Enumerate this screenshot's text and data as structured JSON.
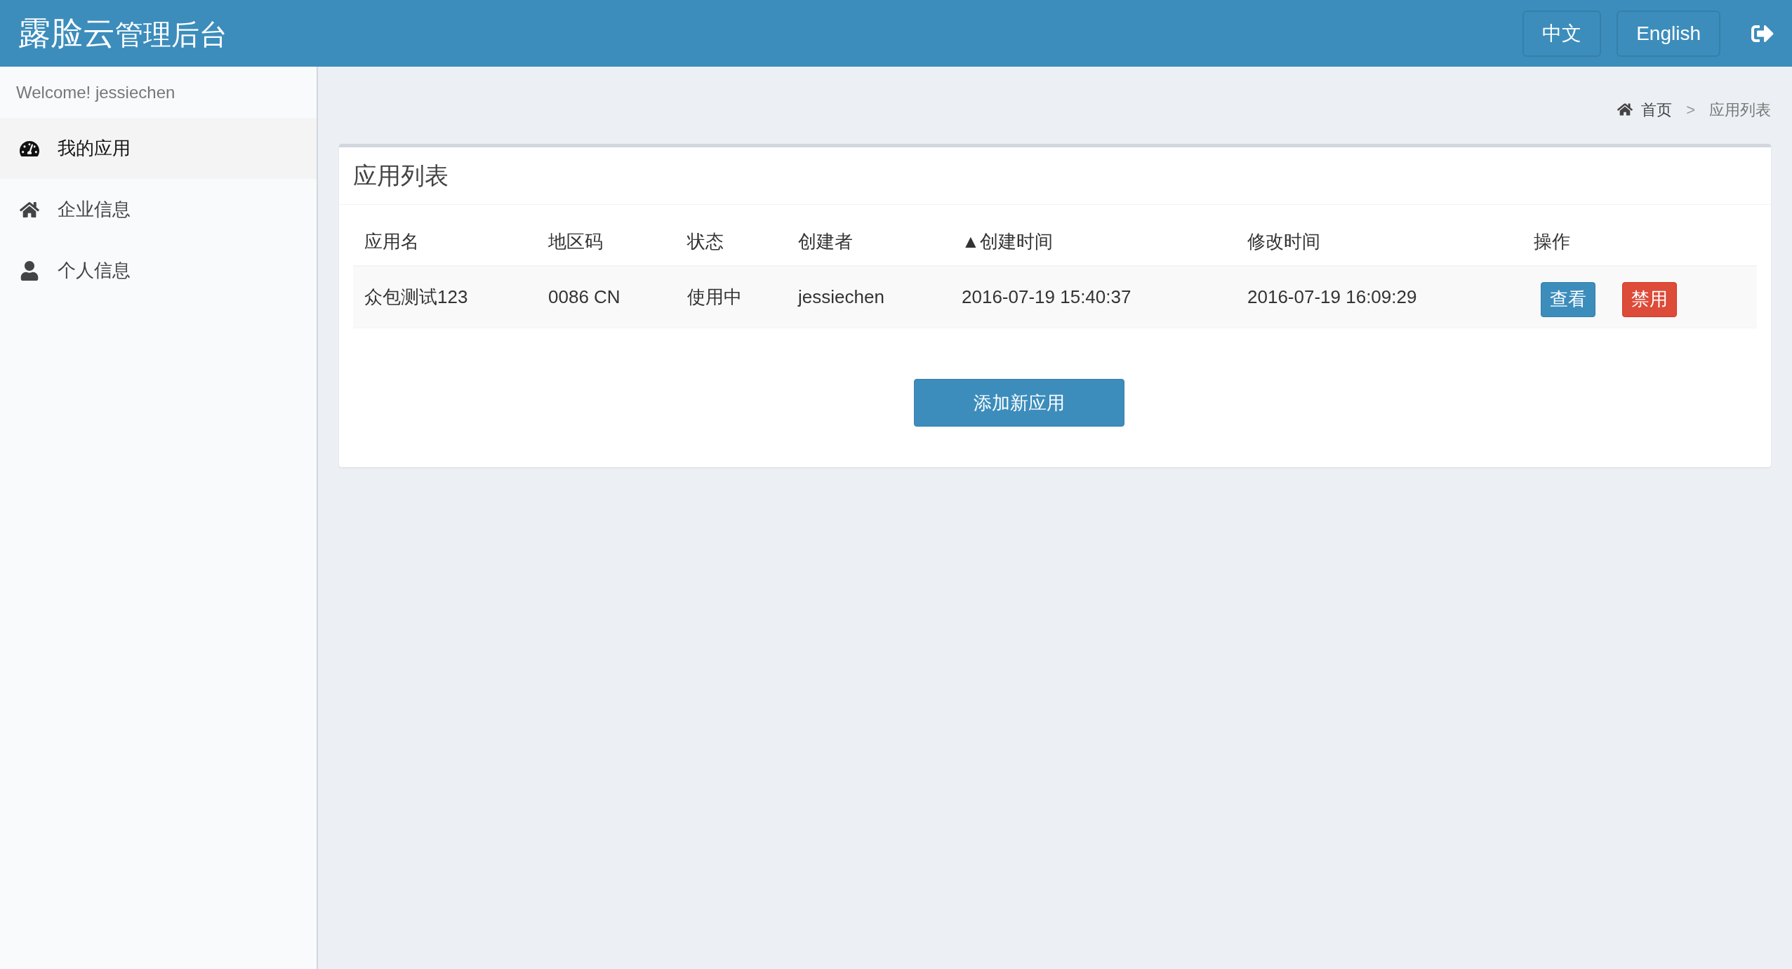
{
  "header": {
    "brand_bold": "露脸云",
    "brand_rest": "管理后台",
    "languages": [
      {
        "label": "中文"
      },
      {
        "label": "English"
      }
    ]
  },
  "sidebar": {
    "welcome": "Welcome! jessiechen",
    "items": [
      {
        "label": "我的应用",
        "kind": "dashboard",
        "selected": true
      },
      {
        "label": "企业信息",
        "kind": "home",
        "selected": false
      },
      {
        "label": "个人信息",
        "kind": "user",
        "selected": false
      }
    ]
  },
  "breadcrumb": {
    "home": "首页",
    "separator": ">",
    "current": "应用列表"
  },
  "panel": {
    "title": "应用列表",
    "table": {
      "columns": [
        "应用名",
        "地区码",
        "状态",
        "创建者",
        "▲创建时间",
        "修改时间",
        "操作"
      ],
      "rows": [
        {
          "cells": [
            "众包测试123",
            "0086 CN",
            "使用中",
            "jessiechen",
            "2016-07-19 15:40:37",
            "2016-07-19 16:09:29"
          ],
          "actions": [
            {
              "label": "查看",
              "kind": "primary"
            },
            {
              "label": "禁用",
              "kind": "danger"
            }
          ]
        }
      ]
    },
    "add_button": "添加新应用"
  }
}
